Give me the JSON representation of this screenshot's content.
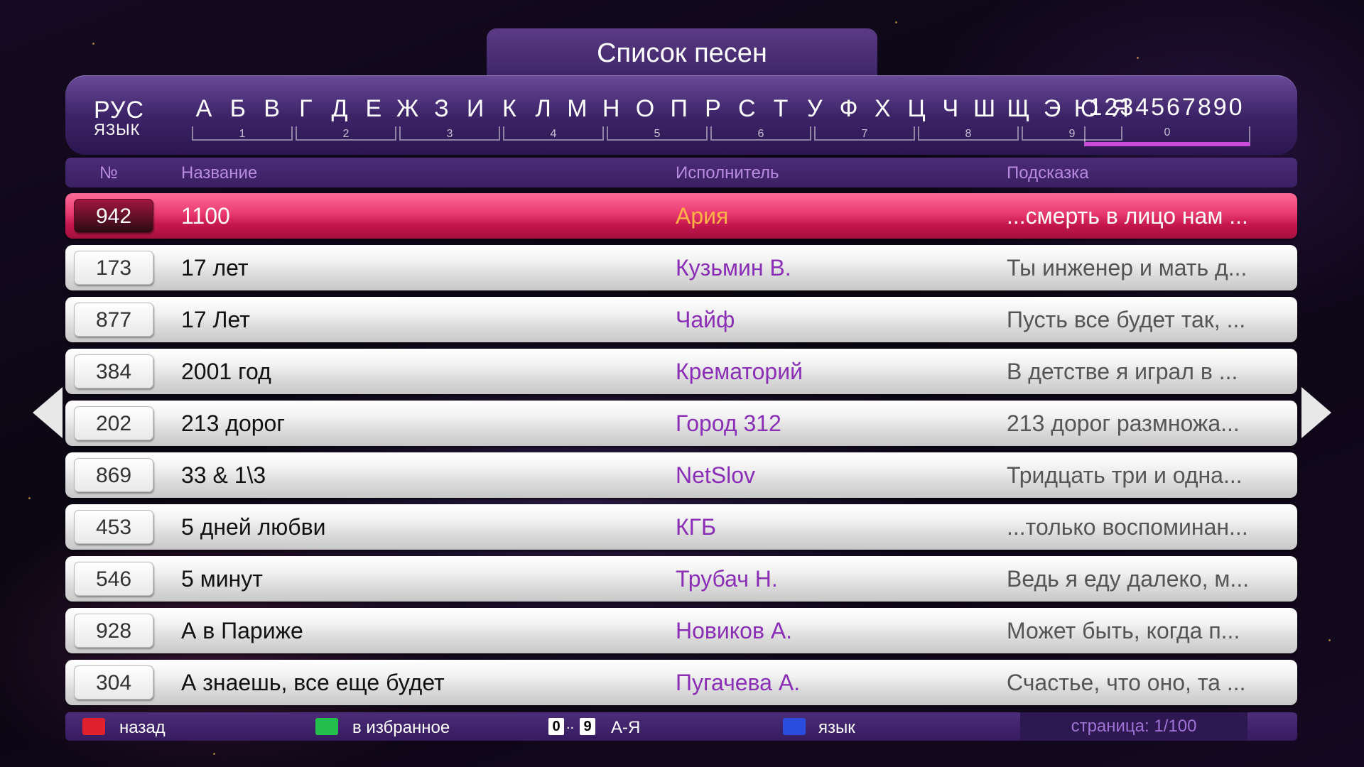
{
  "header": {
    "title": "Список песен"
  },
  "alphabet_bar": {
    "language": "РУС",
    "language_sub": "ЯЗЫК",
    "letters": [
      "А",
      "Б",
      "В",
      "Г",
      "Д",
      "Е",
      "Ж",
      "З",
      "И",
      "К",
      "Л",
      "М",
      "Н",
      "О",
      "П",
      "Р",
      "С",
      "Т",
      "У",
      "Ф",
      "Х",
      "Ц",
      "Ч",
      "Ш",
      "Щ",
      "Э",
      "Ю",
      "Я"
    ],
    "digit_groups": [
      "1",
      "2",
      "3",
      "4",
      "5",
      "6",
      "7",
      "8",
      "9"
    ],
    "digits": "1234567890",
    "digits_group": "0"
  },
  "columns": {
    "number": "№",
    "title": "Название",
    "artist": "Исполнитель",
    "hint": "Подсказка"
  },
  "songs": [
    {
      "num": "942",
      "title": "1100",
      "artist": "Ария",
      "hint": "...смерть в лицо нам ...",
      "selected": true
    },
    {
      "num": "173",
      "title": "17 лет",
      "artist": "Кузьмин В.",
      "hint": "Ты инженер и мать д..."
    },
    {
      "num": "877",
      "title": "17 Лет",
      "artist": "Чайф",
      "hint": "Пусть все будет так, ..."
    },
    {
      "num": "384",
      "title": "2001 год",
      "artist": "Крематорий",
      "hint": "В детстве я играл в ..."
    },
    {
      "num": "202",
      "title": "213 дорог",
      "artist": "Город 312",
      "hint": "213 дорог размножа..."
    },
    {
      "num": "869",
      "title": "33 & 1\\3",
      "artist": "NetSlov",
      "hint": "Тридцать три и одна..."
    },
    {
      "num": "453",
      "title": "5 дней любви",
      "artist": "КГБ",
      "hint": "...только воспоминан..."
    },
    {
      "num": "546",
      "title": "5 минут",
      "artist": "Трубач Н.",
      "hint": "Ведь я еду далеко, м..."
    },
    {
      "num": "928",
      "title": "А в Париже",
      "artist": "Новиков А.",
      "hint": "Может быть, когда п..."
    },
    {
      "num": "304",
      "title": "А знаешь, все еще будет",
      "artist": "Пугачева А.",
      "hint": "Счастье, что оно, та ..."
    }
  ],
  "footer": {
    "red_label": "назад",
    "green_label": "в избранное",
    "digit_from": "0",
    "digit_sep": "..",
    "digit_to": "9",
    "az_label": "А-Я",
    "blue_label": "язык",
    "page": "страница: 1/100"
  },
  "colors": {
    "red_key": "#e0202a",
    "green_key": "#22c04a",
    "blue_key": "#2a4de0",
    "selected_row": "#e83a6f",
    "artist": "#8a2eb5",
    "accent_underline": "#c94bd8"
  }
}
